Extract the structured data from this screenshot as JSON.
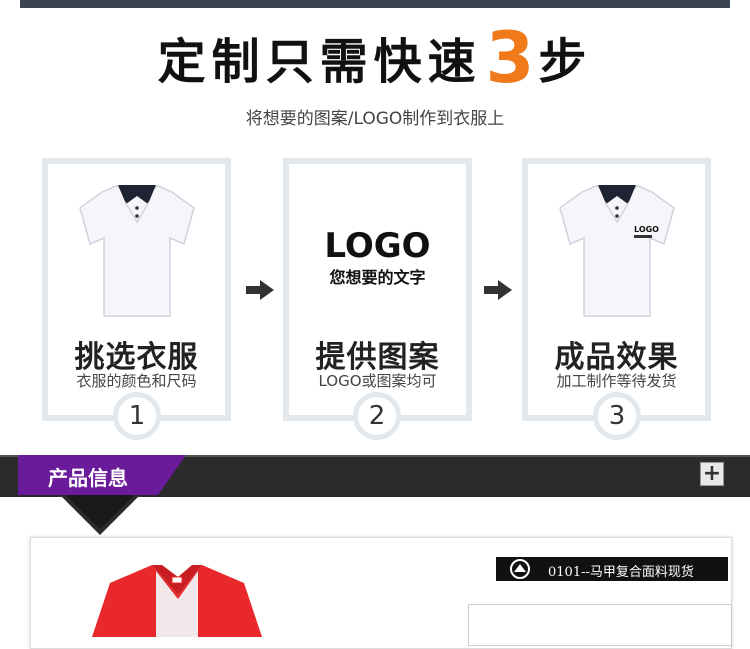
{
  "headline": {
    "part1": "定制只需快速",
    "number": "3",
    "part2": "步"
  },
  "subtitle": "将想要的图案/LOGO制作到衣服上",
  "steps": [
    {
      "title": "挑选衣服",
      "desc": "衣服的颜色和尺码",
      "number": "1"
    },
    {
      "title": "提供图案",
      "desc": "LOGO或图案均可",
      "number": "2",
      "logo_word": "LOGO",
      "logo_sub": "您想要的文字"
    },
    {
      "title": "成品效果",
      "desc": "加工制作等待发货",
      "number": "3",
      "shirt_logo": "LOGO"
    }
  ],
  "section_bar": {
    "label": "产品信息",
    "toggle": "+"
  },
  "product": {
    "tag": "0101--马甲复合面料现货"
  },
  "colors": {
    "accent": "#f07a1a",
    "bar": "#2b2b2b",
    "tab": "#6a1b9a",
    "vest": "#e8282b"
  }
}
